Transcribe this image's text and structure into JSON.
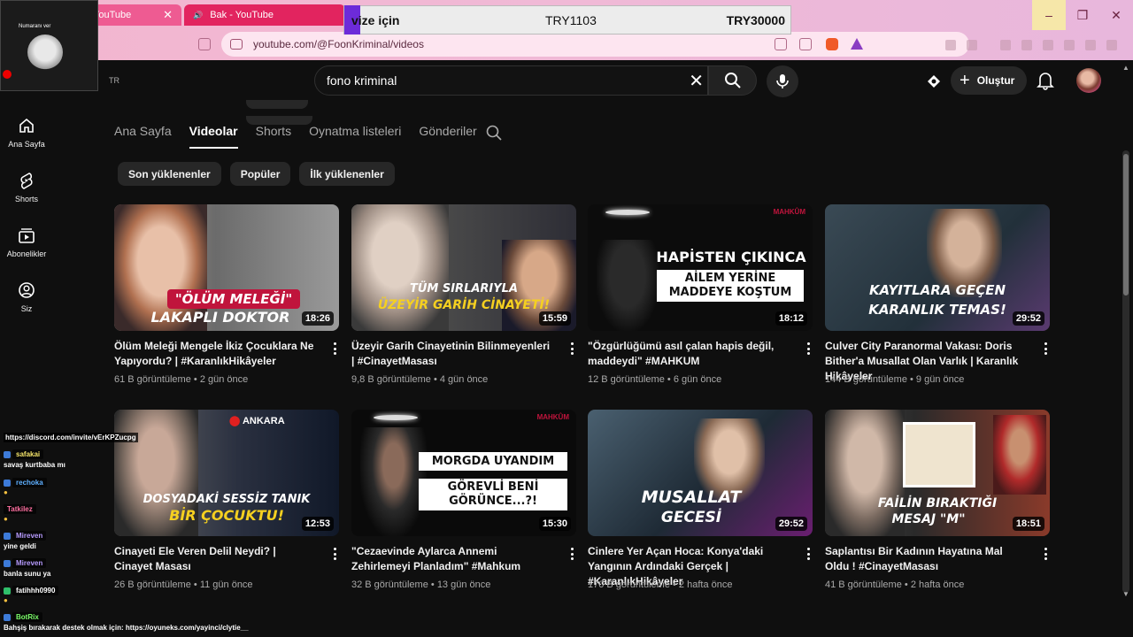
{
  "browser": {
    "tabs": [
      {
        "label": "YouTube"
      },
      {
        "label": "Bak - YouTube"
      }
    ],
    "url": "youtube.com/@FoonKriminal/videos"
  },
  "price_overlay": {
    "label": "vize için",
    "value1": "TRY1103",
    "value2": "TRY30000"
  },
  "webcam": {
    "label": "Numaranı ver"
  },
  "youtube": {
    "region": "TR",
    "search_value": "fono kriminal",
    "create_label": "Oluştur",
    "sidebar": [
      {
        "label": "Ana Sayfa",
        "icon": "home-icon"
      },
      {
        "label": "Shorts",
        "icon": "shorts-icon"
      },
      {
        "label": "Abonelikler",
        "icon": "subscriptions-icon"
      },
      {
        "label": "Siz",
        "icon": "you-icon"
      }
    ],
    "tabs": [
      "Ana Sayfa",
      "Videolar",
      "Shorts",
      "Oynatma listeleri",
      "Gönderiler"
    ],
    "active_tab": "Videolar",
    "filters": [
      "Son yüklenenler",
      "Popüler",
      "İlk yüklenenler"
    ],
    "videos": [
      {
        "title": "Ölüm Meleği Mengele İkiz Çocuklara Ne Yapıyordu? | #KaranlıkHikâyeler",
        "views": "61 B görüntüleme",
        "age": "2 gün önce",
        "duration": "18:26",
        "cap1": "\"ÖLÜM MELEĞİ\"",
        "cap2": "LAKAPLI DOKTOR"
      },
      {
        "title": "Üzeyir Garih Cinayetinin Bilinmeyenleri | #CinayetMasası",
        "views": "9,8 B görüntüleme",
        "age": "4 gün önce",
        "duration": "15:59",
        "cap1": "TÜM SIRLARIYLA",
        "cap2": "ÜZEYİR GARİH CİNAYETİ!"
      },
      {
        "title": "\"Özgürlüğümü asıl çalan hapis değil, maddeydi\" #MAHKUM",
        "views": "12 B görüntüleme",
        "age": "6 gün önce",
        "duration": "18:12",
        "cap1": "HAPİSTEN ÇIKINCA",
        "cap2": "AİLEM YERİNE MADDEYE KOŞTUM",
        "badge": "MAHKÛM"
      },
      {
        "title": "Culver City Paranormal Vakası: Doris Bither'a Musallat Olan Varlık | Karanlık Hikâyeler",
        "views": "144 B görüntüleme",
        "age": "9 gün önce",
        "duration": "29:52",
        "cap1": "KAYITLARA GEÇEN",
        "cap2": "KARANLIK TEMAS!"
      },
      {
        "title": "Cinayeti Ele Veren Delil Neydi? | Cinayet Masası",
        "views": "26 B görüntüleme",
        "age": "11 gün önce",
        "duration": "12:53",
        "cap1": "DOSYADAKİ SESSİZ TANIK",
        "cap2": "BİR ÇOCUKTU!",
        "badge": "ANKARA"
      },
      {
        "title": "\"Cezaevinde Aylarca Annemi Zehirlemeyi Planladım\" #Mahkum",
        "views": "32 B görüntüleme",
        "age": "13 gün önce",
        "duration": "15:30",
        "cap1": "MORGDA UYANDIM",
        "cap2": "GÖREVLİ BENİ GÖRÜNCE...?!",
        "badge": "MAHKÛM"
      },
      {
        "title": "Cinlere Yer Açan Hoca: Konya'daki Yangının Ardındaki Gerçek | #KaranlıkHikâyeler",
        "views": "170 B görüntüleme",
        "age": "2 hafta önce",
        "duration": "29:52",
        "cap1": "MUSALLAT",
        "cap2": "GECESİ"
      },
      {
        "title": "Saplantısı Bir Kadının Hayatına Mal Oldu ! #CinayetMasası",
        "views": "41 B görüntüleme",
        "age": "2 hafta önce",
        "duration": "18:51",
        "cap1": "FAİLİN BIRAKTIĞI",
        "cap2": "MESAJ \"M\""
      }
    ]
  },
  "chat": {
    "link": "https://discord.com/invite/vErKPZucpg",
    "messages": [
      {
        "user": "safakai",
        "text": "savaş kurtbaba mı"
      },
      {
        "user": "rechoka",
        "text": ""
      },
      {
        "user": "Tatkilez",
        "text": ""
      },
      {
        "user": "Mireven",
        "text": "yine geldi"
      },
      {
        "user": "Mireven",
        "text": "banla sunu ya"
      },
      {
        "user": "fatihhh0990",
        "text": ""
      },
      {
        "user": "BotRix",
        "text": "Bahşiş bırakarak destek olmak için: https://oyuneks.com/yayinci/clytie__"
      }
    ]
  }
}
